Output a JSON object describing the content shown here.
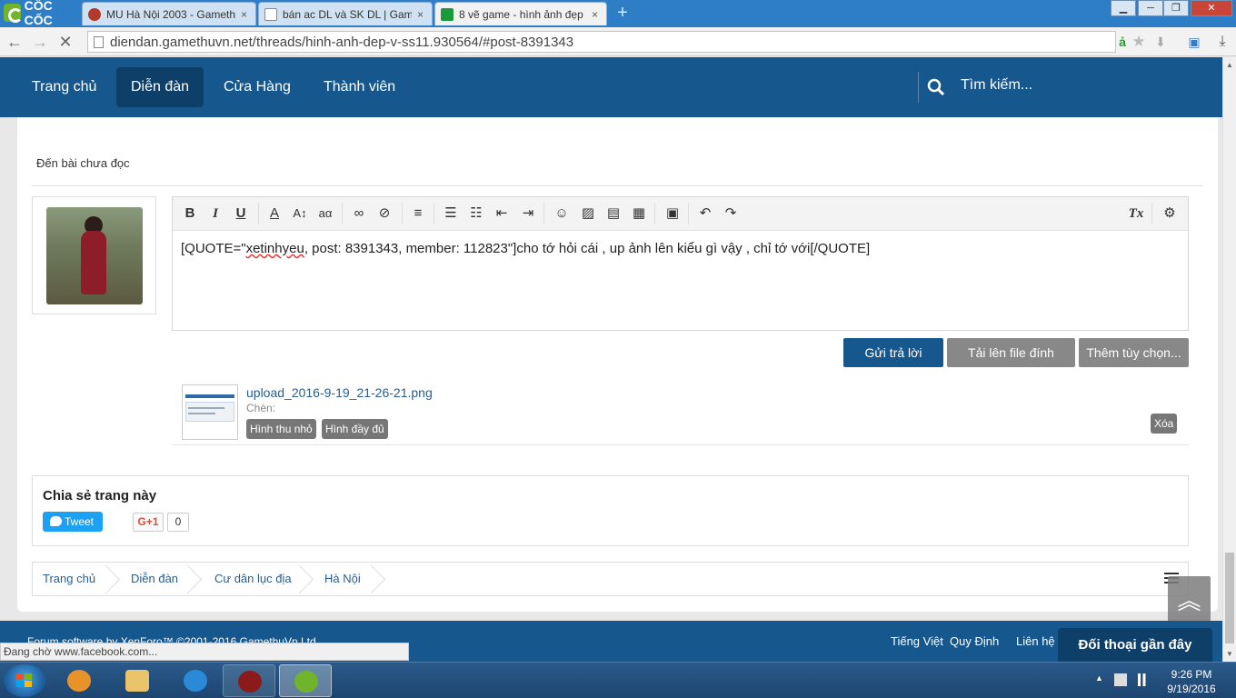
{
  "browser": {
    "brand": "CỐC CỐC",
    "tabs": [
      {
        "title": "MU Hà Nội 2003 - Gameth",
        "close": "×",
        "favicon_color": "#b23a2a"
      },
      {
        "title": "bán ac DL và SK DL | Game",
        "close": "×",
        "favicon_color": "#ffffff"
      },
      {
        "title": "8 vẽ game - hình ảnh đẹp",
        "close": "×",
        "favicon_color": "#1a9a3a"
      }
    ],
    "new_tab": "+",
    "url": "diendan.gamethuvn.net/threads/hinh-anh-dep-v-ss11.930564/#post-8391343",
    "status_text": "Đang chờ www.facebook.com..."
  },
  "nav": {
    "items": [
      "Trang chủ",
      "Diễn đàn",
      "Cửa Hàng",
      "Thành viên"
    ],
    "selected": "Diễn đàn",
    "search_label": "Tìm kiếm..."
  },
  "page": {
    "unread_link": "Đến bài chưa đọc",
    "editor_text_prefix": "[QUOTE=\"",
    "editor_text_user": "xetinhyeu",
    "editor_text_suffix": ", post: 8391343, member: 112823\"]cho tớ hỏi cái , up ảnh lên kiểu gì vậy , chỉ tớ với[/QUOTE]",
    "buttons": {
      "reply": "Gửi trả lời",
      "upload": "Tải lên file đính kèm",
      "more": "Thêm tùy chọn..."
    },
    "attachment": {
      "filename": "upload_2016-9-19_21-26-21.png",
      "insert_label": "Chèn:",
      "thumb_btn": "Hình thu nhỏ",
      "full_btn": "Hình đầy đủ",
      "delete_btn": "Xóa"
    },
    "share": {
      "title": "Chia sẻ trang này",
      "tweet": "Tweet",
      "gplus": "G+1",
      "gplus_count": "0"
    },
    "breadcrumb": [
      "Trang chủ",
      "Diễn đàn",
      "Cư dân lục địa",
      "Hà Nội"
    ]
  },
  "footer": {
    "copyright": "Forum software by XenForo™ ©2001-2016 GamethuVn Ltd.",
    "links": [
      "Tiếng Việt",
      "Quy Định",
      "Liên hệ"
    ],
    "chat": "Đối thoại gần đây"
  },
  "taskbar": {
    "time": "9:26 PM",
    "date": "9/19/2016"
  },
  "colors": {
    "nav_bg": "#16588e",
    "primary_button": "#16588e",
    "link": "#2a5d8e"
  }
}
